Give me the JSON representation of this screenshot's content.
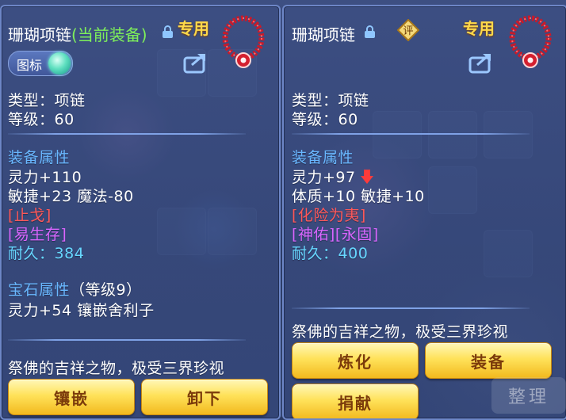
{
  "left_panel": {
    "item_name": "珊瑚项链",
    "equipped_tag": "(当前装备)",
    "special_tag": "专用",
    "icon_toggle_label": "图标",
    "type_line": "类型：项链",
    "level_line": "等级：60",
    "attr_title": "装备属性",
    "attr_line1": "灵力+110",
    "attr_line2": "敏捷+23 魔法-80",
    "skill": "[止戈]",
    "effect": "[易生存]",
    "durability_label": "耐久：",
    "durability_value": "384",
    "gem_title": "宝石属性",
    "gem_level": "（等级9）",
    "gem_line": "灵力+54 镶嵌舍利子",
    "description": "祭佛的吉祥之物，极受三界珍视",
    "btn_inlay": "镶嵌",
    "btn_remove": "卸下"
  },
  "right_panel": {
    "item_name": "珊瑚项链",
    "rate_badge": "评",
    "special_tag": "专用",
    "type_line": "类型：项链",
    "level_line": "等级：60",
    "attr_title": "装备属性",
    "attr_line1": "灵力+97",
    "attr_line2": "体质+10 敏捷+10",
    "skill": "[化险为夷]",
    "effect": "[神佑][永固]",
    "durability_label": "耐久：",
    "durability_value": "400",
    "description": "祭佛的吉祥之物，极受三界珍视",
    "btn_refine": "炼化",
    "btn_equip": "装备",
    "btn_donate": "捐献"
  },
  "background": {
    "sort_button": "整理"
  },
  "colors": {
    "panel_bg": "#3c4e82",
    "button_gold": "#ffe25a",
    "green_text": "#7ef05a",
    "attr_title_blue": "#69b7ff",
    "skill_red": "#ff5858",
    "effect_purple": "#d966ff",
    "durability_cyan": "#67d7ff",
    "special_gold": "#ffd94a"
  },
  "icons": {
    "lock": "lock-icon",
    "share": "share-icon",
    "necklace": "coral-necklace-icon",
    "down_arrow": "down-arrow-icon",
    "rate": "rate-badge-icon"
  }
}
